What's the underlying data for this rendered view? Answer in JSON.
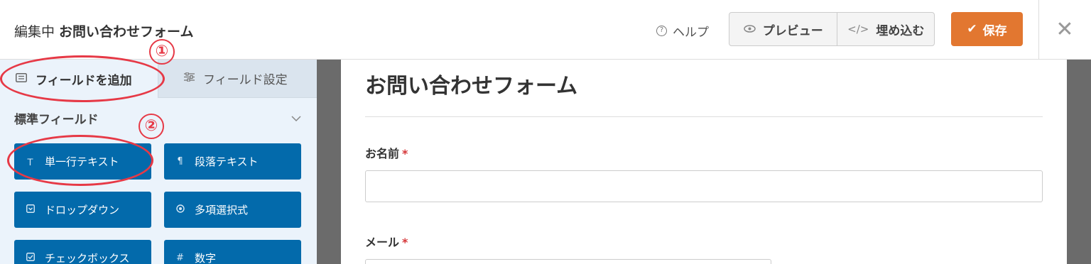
{
  "header": {
    "editing_prefix": "編集中",
    "form_name": "お問い合わせフォーム",
    "help_label": "ヘルプ",
    "preview_label": "プレビュー",
    "embed_label": "埋め込む",
    "save_label": "保存",
    "accent_color": "#e27730"
  },
  "sidebar": {
    "tabs": [
      {
        "label": "フィールドを追加",
        "icon": "list-icon",
        "active": true
      },
      {
        "label": "フィールド設定",
        "icon": "sliders-icon",
        "active": false
      }
    ],
    "section_title": "標準フィールド",
    "fields": [
      {
        "label": "単一行テキスト",
        "icon": "text-icon"
      },
      {
        "label": "段落テキスト",
        "icon": "paragraph-icon"
      },
      {
        "label": "ドロップダウン",
        "icon": "dropdown-icon"
      },
      {
        "label": "多項選択式",
        "icon": "radio-icon"
      },
      {
        "label": "チェックボックス",
        "icon": "checkbox-icon"
      },
      {
        "label": "数字",
        "icon": "hash-icon"
      }
    ],
    "button_color": "#036aab"
  },
  "annotations": {
    "step1": "①",
    "step2": "②",
    "color": "#e63946"
  },
  "form": {
    "title": "お問い合わせフォーム",
    "fields": [
      {
        "label": "お名前",
        "required": "*"
      },
      {
        "label": "メール",
        "required": "*"
      }
    ]
  }
}
